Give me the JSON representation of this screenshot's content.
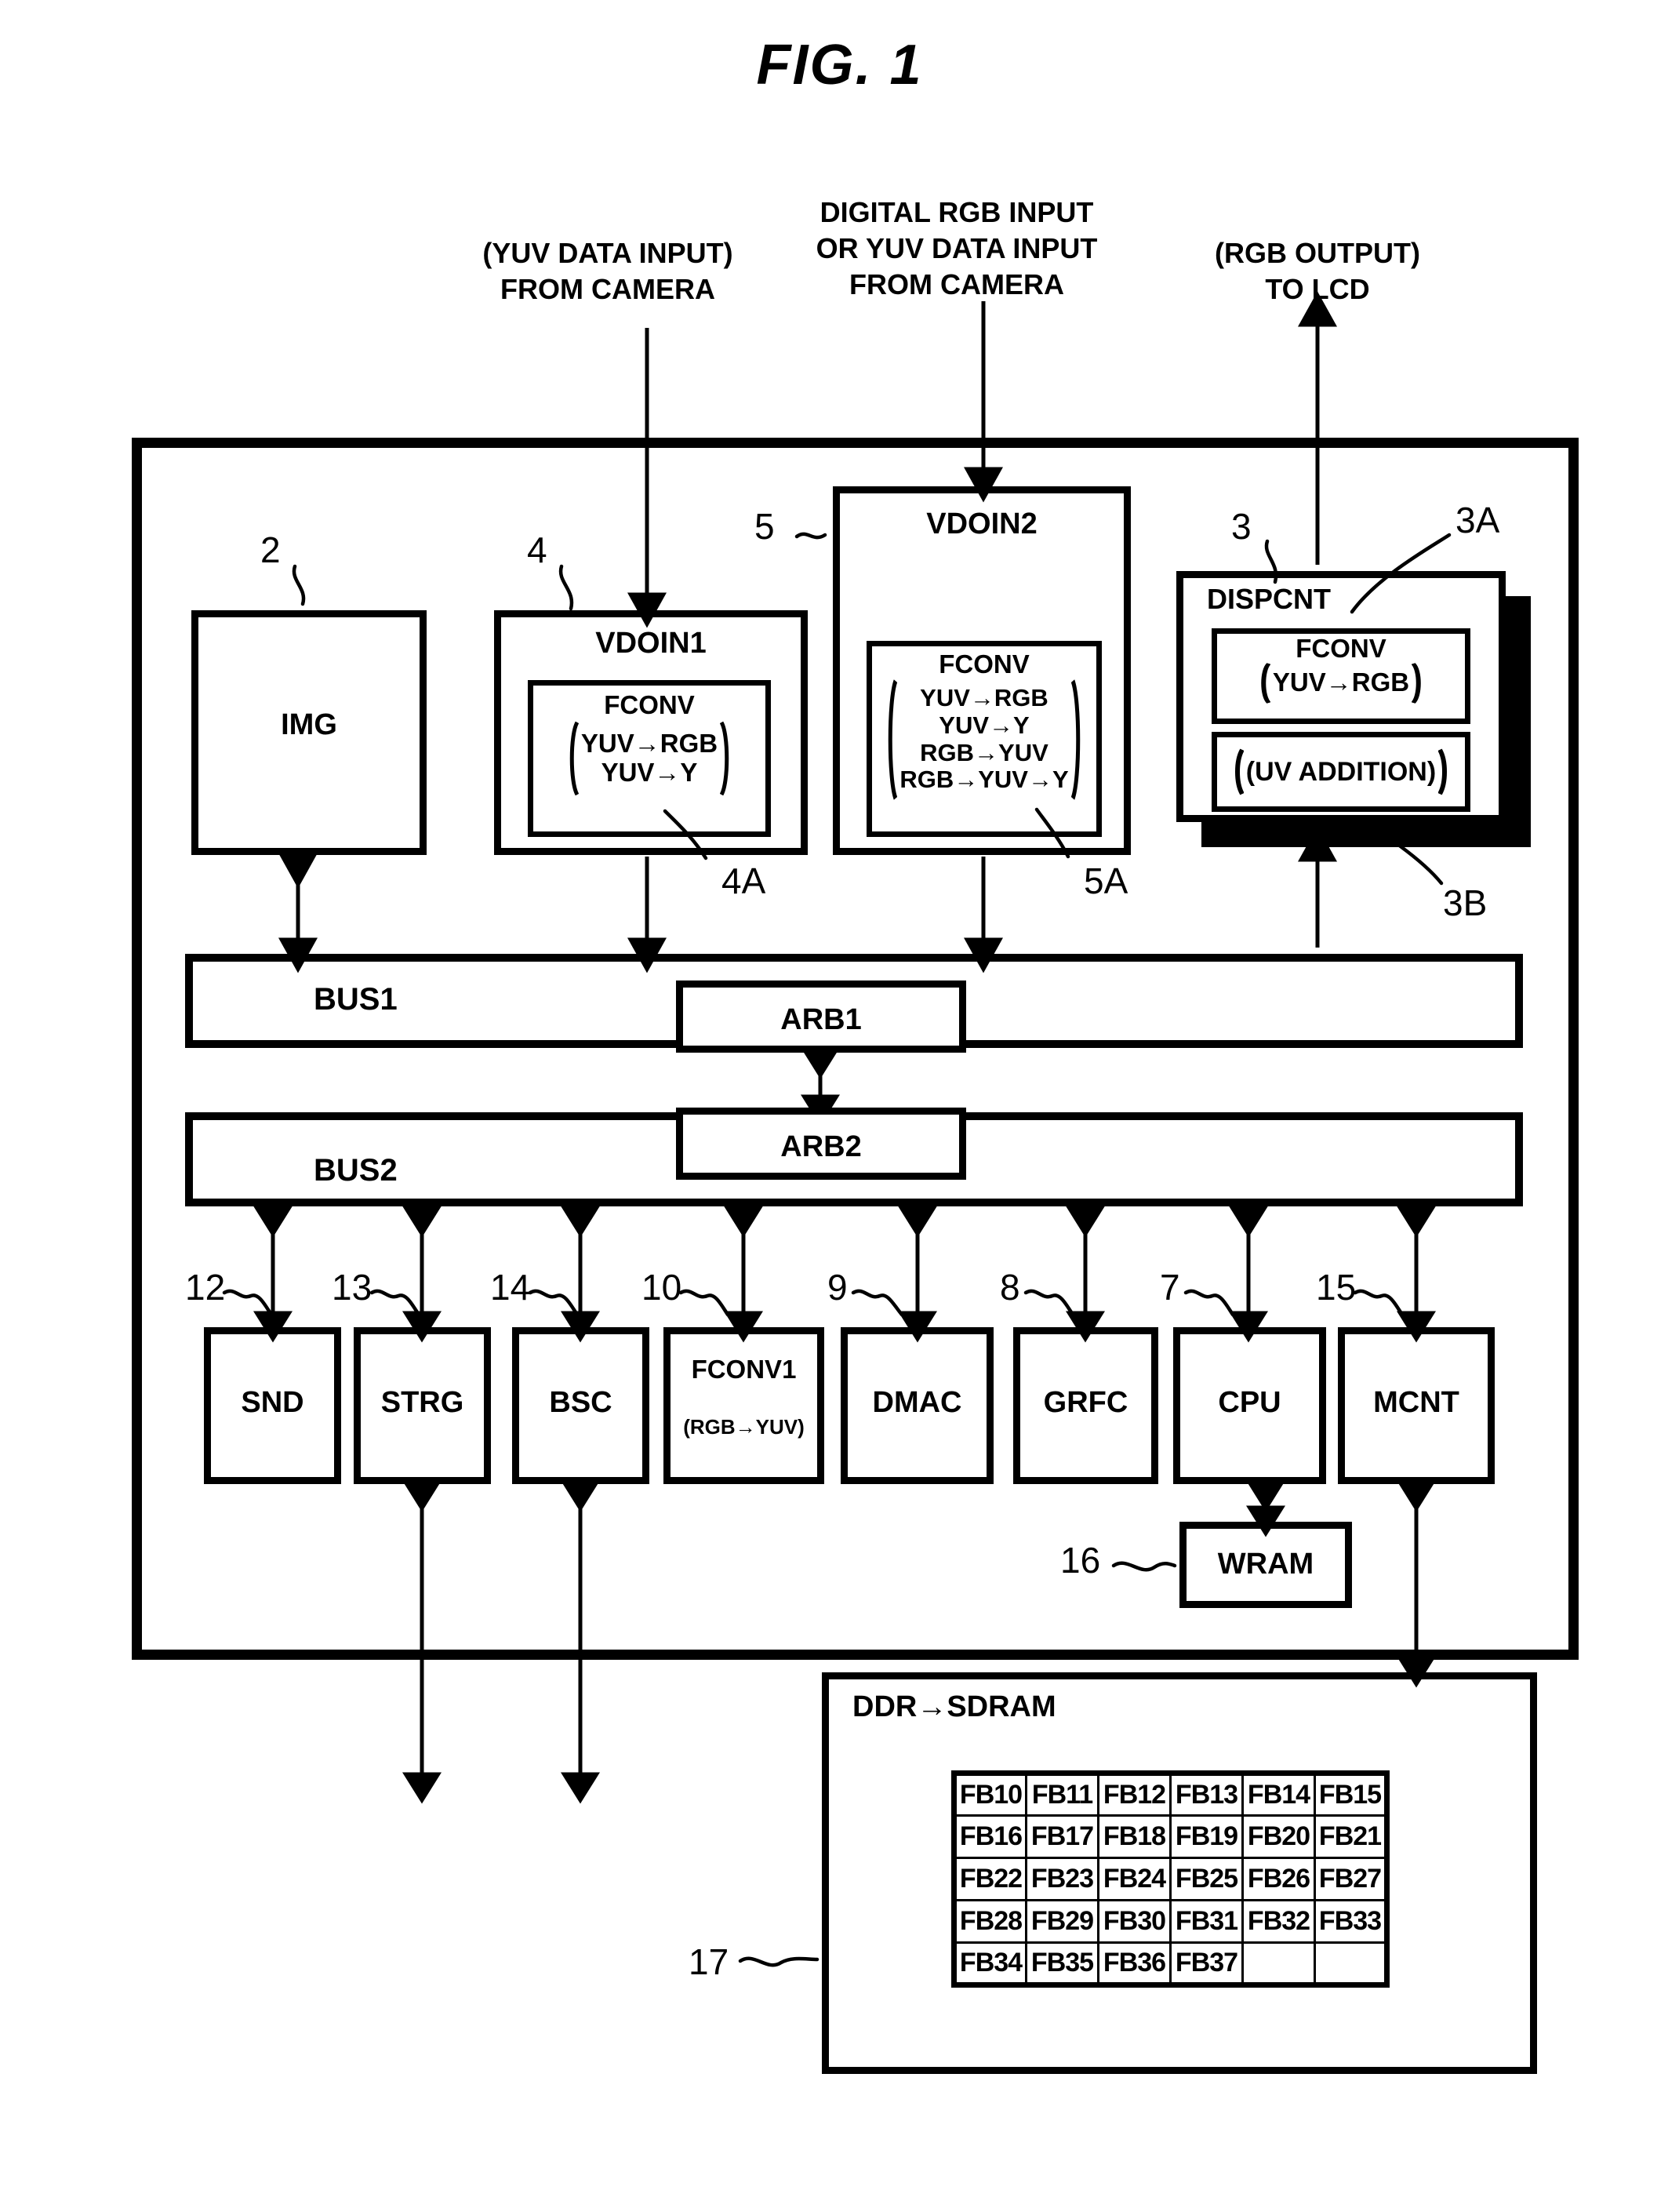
{
  "figure": {
    "title": "FIG.  1"
  },
  "captions": {
    "left": "(YUV DATA INPUT)\nFROM CAMERA",
    "center": "DIGITAL RGB INPUT\nOR YUV DATA INPUT\nFROM CAMERA",
    "right": "(RGB OUTPUT)\nTO LCD"
  },
  "chip": {
    "img": {
      "label": "IMG",
      "ref": "2"
    },
    "vdoin1": {
      "label": "VDOIN1",
      "ref": "4",
      "fconv": {
        "label": "FCONV",
        "ref": "4A",
        "lines": "YUV→RGB\nYUV→Y"
      }
    },
    "vdoin2": {
      "label": "VDOIN2",
      "ref": "5",
      "fconv": {
        "label": "FCONV",
        "ref": "5A",
        "lines": "YUV→RGB\nYUV→Y\nRGB→YUV\nRGB→YUV→Y"
      }
    },
    "dispcnt": {
      "label": "DISPCNT",
      "ref": "3",
      "fconv": {
        "label": "FCONV",
        "ref": "3A",
        "lines": "YUV→RGB"
      },
      "uv_addition": {
        "label": "(UV ADDITION)",
        "ref": "3B"
      }
    },
    "bus1": {
      "label": "BUS1",
      "arbiter": "ARB1"
    },
    "bus2": {
      "label": "BUS2",
      "arbiter": "ARB2"
    },
    "peripherals": [
      {
        "ref": "12",
        "label": "SND",
        "sub": ""
      },
      {
        "ref": "13",
        "label": "STRG",
        "sub": ""
      },
      {
        "ref": "14",
        "label": "BSC",
        "sub": ""
      },
      {
        "ref": "10",
        "label": "FCONV1",
        "sub": "(RGB→YUV)"
      },
      {
        "ref": "9",
        "label": "DMAC",
        "sub": ""
      },
      {
        "ref": "8",
        "label": "GRFC",
        "sub": ""
      },
      {
        "ref": "7",
        "label": "CPU",
        "sub": ""
      },
      {
        "ref": "15",
        "label": "MCNT",
        "sub": ""
      }
    ],
    "wram": {
      "label": "WRAM",
      "ref": "16"
    }
  },
  "memory": {
    "ref": "17",
    "title": "DDR→SDRAM",
    "frame_buffers": [
      [
        "FB10",
        "FB11",
        "FB12",
        "FB13",
        "FB14",
        "FB15"
      ],
      [
        "FB16",
        "FB17",
        "FB18",
        "FB19",
        "FB20",
        "FB21"
      ],
      [
        "FB22",
        "FB23",
        "FB24",
        "FB25",
        "FB26",
        "FB27"
      ],
      [
        "FB28",
        "FB29",
        "FB30",
        "FB31",
        "FB32",
        "FB33"
      ],
      [
        "FB34",
        "FB35",
        "FB36",
        "FB37",
        "",
        ""
      ]
    ]
  },
  "colors": {
    "ink": "#000000",
    "paper": "#ffffff"
  }
}
